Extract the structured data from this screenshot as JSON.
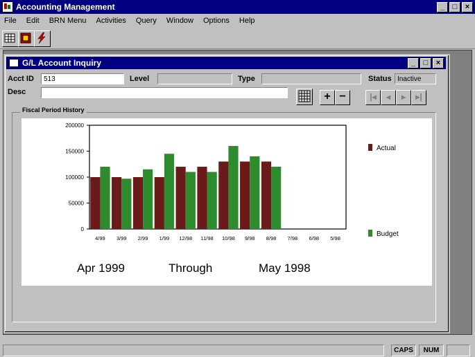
{
  "app": {
    "title": "Accounting Management",
    "window_buttons": [
      "_",
      "□",
      "×"
    ]
  },
  "menu": [
    "File",
    "Edit",
    "BRN Menu",
    "Activities",
    "Query",
    "Window",
    "Options",
    "Help"
  ],
  "child": {
    "title": "G/L Account Inquiry",
    "fields": {
      "acct_label": "Acct ID",
      "acct_value": "513",
      "level_label": "Level",
      "level_value": "",
      "type_label": "Type",
      "type_value": "",
      "status_label": "Status",
      "status_value": "Inactive",
      "desc_label": "Desc",
      "desc_value": ""
    },
    "nav": {
      "add": "+",
      "remove": "−",
      "first": "|◂",
      "prev": "◂",
      "next": "▸",
      "last": "▸|"
    },
    "group_label": "Fiscal Period History"
  },
  "chart_data": {
    "type": "bar",
    "categories": [
      "4/99",
      "3/99",
      "2/99",
      "1/99",
      "12/98",
      "11/98",
      "10/98",
      "9/98",
      "8/98",
      "7/98",
      "6/98",
      "5/98"
    ],
    "series": [
      {
        "name": "Actual",
        "color": "#6b1a1a",
        "values": [
          100000,
          100000,
          100000,
          100000,
          120000,
          120000,
          130000,
          130000,
          130000,
          0,
          0,
          0
        ]
      },
      {
        "name": "Budget",
        "color": "#2e8b2e",
        "values": [
          120000,
          97000,
          115000,
          145000,
          110000,
          110000,
          160000,
          140000,
          120000,
          0,
          0,
          0
        ]
      }
    ],
    "y_ticks": [
      "200000",
      "150000",
      "100000",
      "50000",
      "0"
    ],
    "ylim": [
      0,
      200000
    ],
    "range_text": {
      "from": "Apr 1999",
      "through": "Through",
      "to": "May 1998"
    }
  },
  "status": {
    "caps": "CAPS",
    "num": "NUM",
    "empty": ""
  }
}
